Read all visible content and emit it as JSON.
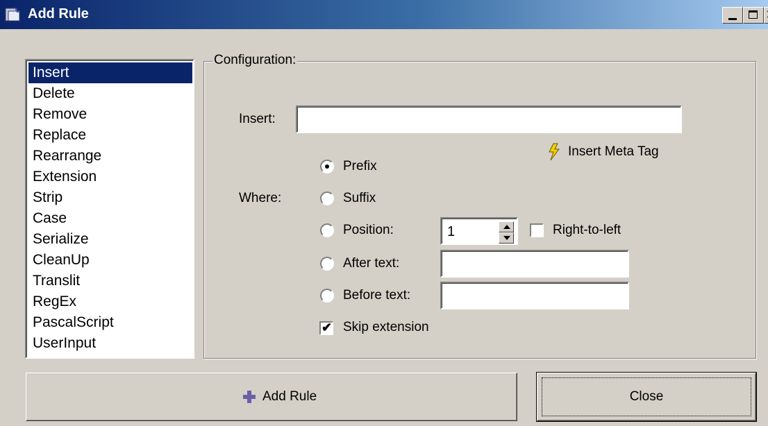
{
  "window": {
    "title": "Add Rule"
  },
  "rules_list": {
    "items": [
      "Insert",
      "Delete",
      "Remove",
      "Replace",
      "Rearrange",
      "Extension",
      "Strip",
      "Case",
      "Serialize",
      "CleanUp",
      "Translit",
      "RegEx",
      "PascalScript",
      "UserInput"
    ],
    "selected": "Insert"
  },
  "config": {
    "legend": "Configuration:",
    "insert_label": "Insert:",
    "insert_value": "",
    "meta_tag_label": "Insert Meta Tag",
    "where_label": "Where:",
    "options": {
      "prefix": "Prefix",
      "suffix": "Suffix",
      "position": "Position:",
      "after_text": "After text:",
      "before_text": "Before text:"
    },
    "selected_option": "Prefix",
    "position_value": "1",
    "after_text_value": "",
    "before_text_value": "",
    "right_to_left_label": "Right-to-left",
    "right_to_left_checked": false,
    "skip_extension_label": "Skip extension",
    "skip_extension_checked": true
  },
  "buttons": {
    "add_rule": "Add Rule",
    "close": "Close"
  },
  "colors": {
    "titlebar": "#0a246a",
    "selection": "#0a246a",
    "face": "#d4d0c8",
    "plus_icon": "#6b5fa5",
    "bolt_icon": "#f0d000"
  },
  "icons": [
    "app-icon",
    "minimize-icon",
    "maximize-icon",
    "close-icon",
    "lightning-icon",
    "plus-icon"
  ]
}
